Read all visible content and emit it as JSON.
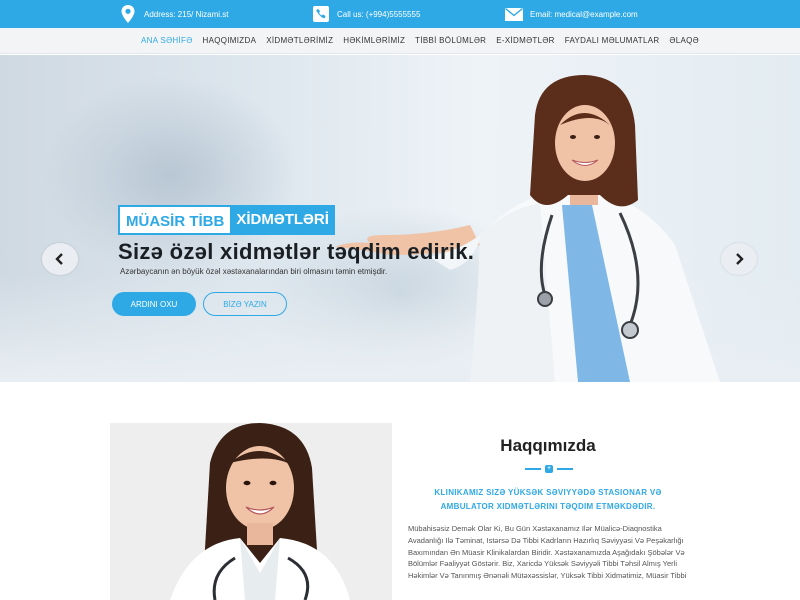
{
  "topbar": {
    "address": "Address: 215/ Nizami.st",
    "phone": "Call us: (+994)5555555",
    "email": "Email: medical@example.com",
    "icons": [
      "location-pin-icon",
      "phone-icon",
      "envelope-icon"
    ]
  },
  "nav": {
    "items": [
      "ANA SƏHİFƏ",
      "HAQQIMIZDA",
      "XİDMƏTLƏRİMİZ",
      "HƏKİMLƏRİMİZ",
      "TİBBİ BÖLÜMLƏR",
      "E-XİDMƏTLƏR",
      "FAYDALI MƏLUMATLAR",
      "ƏLAQƏ"
    ],
    "active_index": 0
  },
  "hero": {
    "badge_part1": "MÜASİR TİBB",
    "badge_part2": "XİDMƏTLƏRİ",
    "title": "Sizə özəl xidmətlər təqdim edirik.",
    "subtitle": "Azərbaycanın ən böyük özəl xəstəxanalarından biri olmasını təmin etmişdir.",
    "primary_button": "ARDINI OXU",
    "secondary_button": "BİZƏ YAZIN"
  },
  "about": {
    "title": "Haqqımızda",
    "lead": "KLINIKAMIZ SIZƏ YÜKSƏK SƏVIYYƏDƏ STASIONAR VƏ AMBULATOR XIDMƏTLƏRINI TƏQDIM ETMƏKDƏDIR.",
    "body": "Mübahisəsiz Demək Olar Ki, Bu Gün Xəstəxanamız Ilər Müalicə-Diaqnostika Avadanlığı Ilə Təminat, Istərsə Də Tibbi Kadrların Hazırlıq Səviyyəsi Və Peşəkarlığı Baxımından Ən Müasir Klinikalardan Biridir. Xəstəxanamızda Aşağıdakı Şöbələr Və Bölümlər Fəaliyyət Göstərir. Biz, Xaricdə Yüksək Səviyyəli Tibbi Təhsil Almış Yerli Həkimlər Və Tanınmış Ənənəli Mütəxəssislər, Yüksək Tibbi Xidmətimiz, Müasir Tibbi"
  },
  "colors": {
    "accent": "#2fa9e6",
    "topbar": "#2fa9e6",
    "nav_bg": "#f3f4f6",
    "heading": "#222222"
  }
}
